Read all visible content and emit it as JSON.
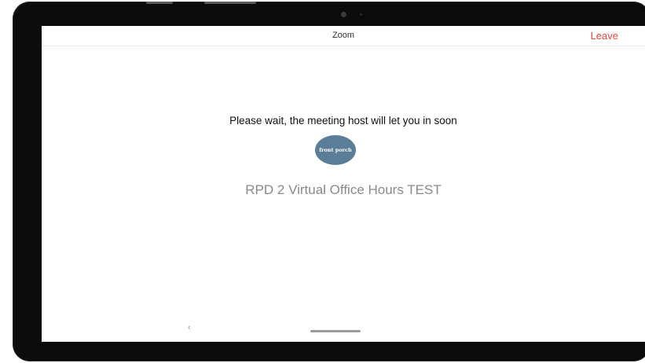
{
  "app": {
    "title": "Zoom",
    "leave_label": "Leave"
  },
  "waiting_room": {
    "message": "Please wait, the meeting host will let you in soon",
    "host_avatar_text": "front porch",
    "meeting_topic": "RPD 2 Virtual Office Hours TEST"
  },
  "nav": {
    "back_glyph": "‹"
  },
  "colors": {
    "leave_accent": "#e5483f",
    "avatar_bg": "#5b7e98",
    "device_bezel": "#0b0b0b"
  },
  "icons": {
    "back": "back-chevron-icon",
    "home": "home-pill-icon",
    "camera": "front-camera-icon"
  }
}
